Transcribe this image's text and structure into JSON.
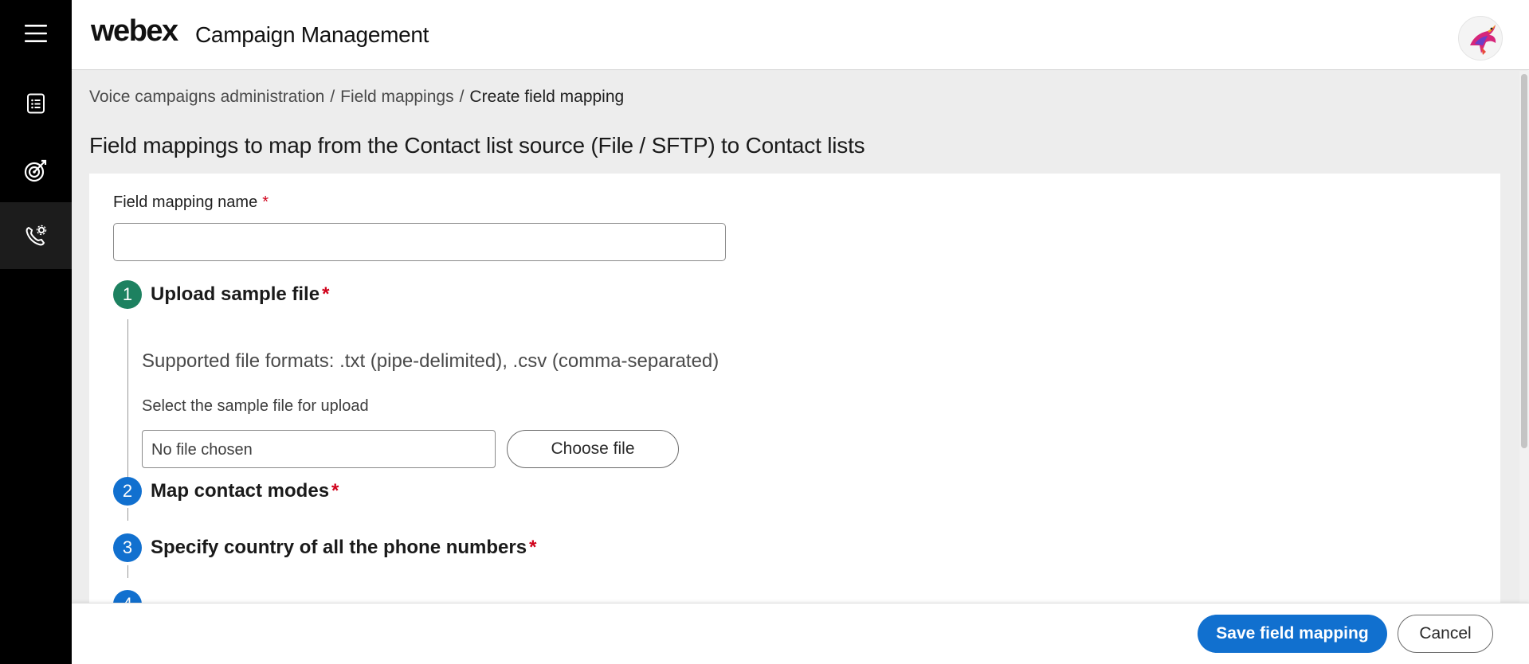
{
  "header": {
    "brand": "webex",
    "product": "Campaign Management",
    "avatar_icon": "bird-logo-icon"
  },
  "sidebar": {
    "items": [
      {
        "icon": "hamburger-menu-icon"
      },
      {
        "icon": "contact-list-icon"
      },
      {
        "icon": "target-campaign-icon"
      },
      {
        "icon": "phone-settings-icon",
        "active": true
      }
    ]
  },
  "breadcrumb": {
    "items": [
      "Voice campaigns administration",
      "Field mappings",
      "Create field mapping"
    ],
    "separator": "/"
  },
  "page_title": "Field mappings to map from the Contact list source (File / SFTP) to Contact lists",
  "form": {
    "name_label": "Field mapping name",
    "name_required": "*",
    "name_value": "",
    "steps": [
      {
        "number": "1",
        "title": "Upload sample file",
        "required": "*",
        "status": "complete"
      },
      {
        "number": "2",
        "title": "Map contact modes",
        "required": "*",
        "status": "pending"
      },
      {
        "number": "3",
        "title": "Specify country of all the phone numbers",
        "required": "*",
        "status": "pending"
      },
      {
        "number": "4",
        "title": "",
        "status": "pending"
      }
    ],
    "upload": {
      "formats_text": "Supported file formats: .txt (pipe-delimited), .csv (comma-separated)",
      "select_label": "Select the sample file for upload",
      "file_status": "No file chosen",
      "choose_label": "Choose file"
    }
  },
  "footer": {
    "save_label": "Save field mapping",
    "cancel_label": "Cancel"
  },
  "colors": {
    "accent": "#1170cf",
    "step_complete": "#1d8160",
    "required": "#d0021b",
    "sidebar": "#000000",
    "content_bg": "#ededed"
  }
}
